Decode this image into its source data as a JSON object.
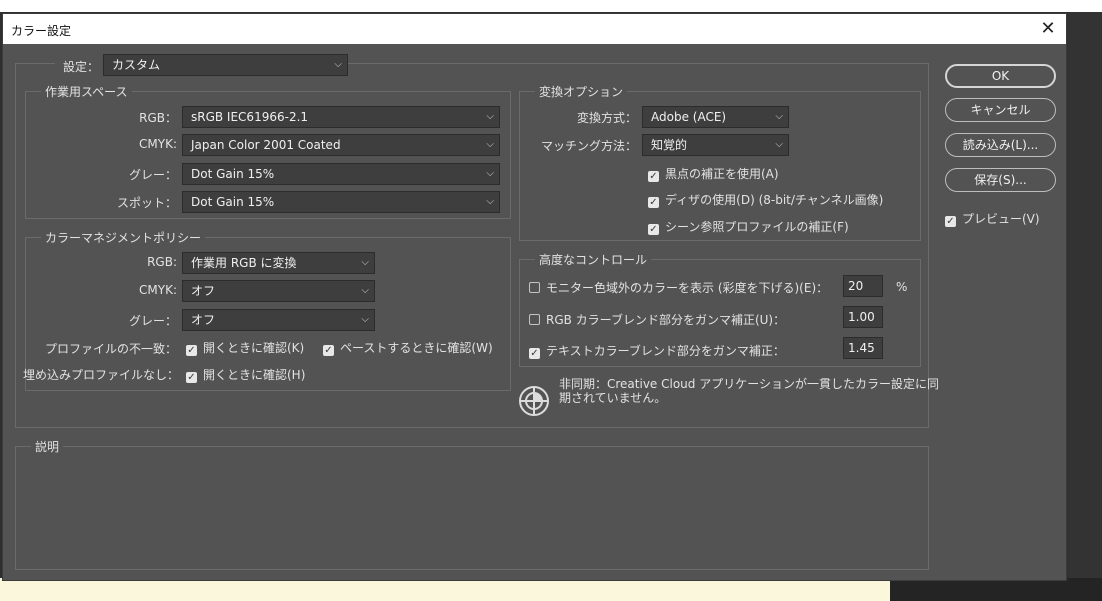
{
  "window": {
    "title": "カラー設定"
  },
  "settings": {
    "label": "設定：",
    "value": "カスタム"
  },
  "working_spaces": {
    "legend": "作業用スペース",
    "rgb": {
      "label": "RGB：",
      "value": "sRGB IEC61966-2.1"
    },
    "cmyk": {
      "label": "CMYK:",
      "value": "Japan Color 2001 Coated"
    },
    "gray": {
      "label": "グレー：",
      "value": "Dot Gain 15%"
    },
    "spot": {
      "label": "スポット：",
      "value": "Dot Gain 15%"
    }
  },
  "color_management": {
    "legend": "カラーマネジメントポリシー",
    "rgb": {
      "label": "RGB:",
      "value": "作業用 RGB に変換"
    },
    "cmyk": {
      "label": "CMYK:",
      "value": "オフ"
    },
    "gray": {
      "label": "グレー：",
      "value": "オフ"
    },
    "profile_mismatch": {
      "label": "プロファイルの不一致：",
      "open": "開くときに確認(K)",
      "paste": "ペーストするときに確認(W)"
    },
    "missing_profile": {
      "label": "埋め込みプロファイルなし：",
      "open": "開くときに確認(H)"
    }
  },
  "conversion": {
    "legend": "変換オプション",
    "engine": {
      "label": "変換方式：",
      "value": "Adobe (ACE)"
    },
    "intent": {
      "label": "マッチング方法：",
      "value": "知覚的"
    },
    "black_point": "黒点の補正を使用(A)",
    "dither": "ディザの使用(D) (8-bit/チャンネル画像)",
    "scene_referred": "シーン参照プロファイルの補正(F)"
  },
  "advanced": {
    "legend": "高度なコントロール",
    "desaturate": {
      "label": "モニター色域外のカラーを表示 (彩度を下げる)(E)：",
      "value": "20",
      "unit": "%"
    },
    "blend_rgb": {
      "label": "RGB カラーブレンド部分をガンマ補正(U)：",
      "value": "1.00"
    },
    "blend_text": {
      "label": "テキストカラーブレンド部分をガンマ補正：",
      "value": "1.45"
    }
  },
  "sync": {
    "line1": "非同期：Creative Cloud アプリケーションが一貫したカラー設定に同",
    "line2": "期されていません。"
  },
  "description": {
    "legend": "説明"
  },
  "buttons": {
    "ok": "OK",
    "cancel": "キャンセル",
    "load": "読み込み(L)...",
    "save": "保存(S)...",
    "preview": "プレビュー(V)"
  },
  "colors": {
    "dialog_bg": "#535353",
    "field_bg": "#3e3e3e",
    "title_bg": "#ffffff",
    "text": "#e2e2e2"
  }
}
